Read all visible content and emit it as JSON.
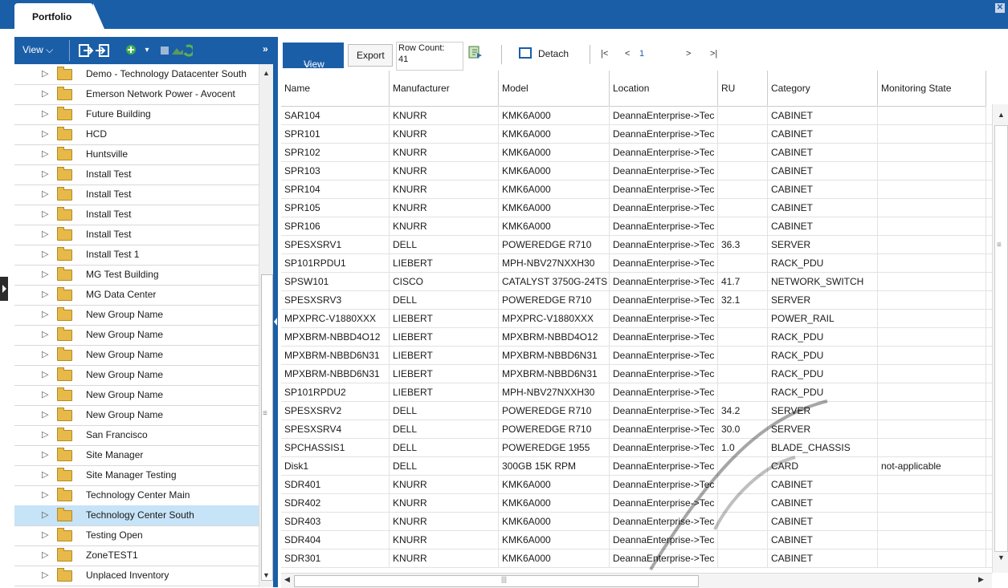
{
  "window": {
    "tab_label": "Portfolio",
    "close_icon": "close-icon"
  },
  "left_panel": {
    "view_label": "View",
    "expand_label": "»",
    "icons": [
      "move-in-icon",
      "move-out-icon",
      "add-icon",
      "dropdown-icon",
      "chart-icon",
      "refresh-icon"
    ],
    "tree_items": [
      {
        "label": "Demo - Technology Datacenter South",
        "selected": false
      },
      {
        "label": "Emerson Network Power - Avocent",
        "selected": false
      },
      {
        "label": "Future Building",
        "selected": false
      },
      {
        "label": "HCD",
        "selected": false
      },
      {
        "label": "Huntsville",
        "selected": false
      },
      {
        "label": "Install Test",
        "selected": false
      },
      {
        "label": "Install Test",
        "selected": false
      },
      {
        "label": "Install Test",
        "selected": false
      },
      {
        "label": "Install Test",
        "selected": false
      },
      {
        "label": "Install Test 1",
        "selected": false
      },
      {
        "label": "MG Test Building",
        "selected": false
      },
      {
        "label": "MG Data Center",
        "selected": false
      },
      {
        "label": "New Group Name",
        "selected": false
      },
      {
        "label": "New Group Name",
        "selected": false
      },
      {
        "label": "New Group Name",
        "selected": false
      },
      {
        "label": "New Group Name",
        "selected": false
      },
      {
        "label": "New Group Name",
        "selected": false
      },
      {
        "label": "New Group Name",
        "selected": false
      },
      {
        "label": "San Francisco",
        "selected": false
      },
      {
        "label": "Site Manager",
        "selected": false
      },
      {
        "label": "Site Manager Testing",
        "selected": false
      },
      {
        "label": "Technology Center Main",
        "selected": false
      },
      {
        "label": "Technology Center South",
        "selected": true
      },
      {
        "label": "Testing Open",
        "selected": false
      },
      {
        "label": "ZoneTEST1",
        "selected": false
      },
      {
        "label": "Unplaced Inventory",
        "selected": false
      }
    ]
  },
  "toolbar": {
    "view_label": "View",
    "export_label": "Export",
    "row_count_label": "Row Count:",
    "row_count_value": "41",
    "detach_label": "Detach",
    "pager": {
      "first": "|<",
      "prev": "<",
      "page": "1",
      "next": ">",
      "last": ">|"
    }
  },
  "grid": {
    "columns": [
      "Name",
      "Manufacturer",
      "Model",
      "Location",
      "RU",
      "Category",
      "Monitoring State"
    ],
    "rows": [
      [
        "SAR104",
        "KNURR",
        "KMK6A000",
        "DeannaEnterprise->Tec",
        "",
        "CABINET",
        ""
      ],
      [
        "SPR101",
        "KNURR",
        "KMK6A000",
        "DeannaEnterprise->Tec",
        "",
        "CABINET",
        ""
      ],
      [
        "SPR102",
        "KNURR",
        "KMK6A000",
        "DeannaEnterprise->Tec",
        "",
        "CABINET",
        ""
      ],
      [
        "SPR103",
        "KNURR",
        "KMK6A000",
        "DeannaEnterprise->Tec",
        "",
        "CABINET",
        ""
      ],
      [
        "SPR104",
        "KNURR",
        "KMK6A000",
        "DeannaEnterprise->Tec",
        "",
        "CABINET",
        ""
      ],
      [
        "SPR105",
        "KNURR",
        "KMK6A000",
        "DeannaEnterprise->Tec",
        "",
        "CABINET",
        ""
      ],
      [
        "SPR106",
        "KNURR",
        "KMK6A000",
        "DeannaEnterprise->Tec",
        "",
        "CABINET",
        ""
      ],
      [
        "SPESXSRV1",
        "DELL",
        "POWEREDGE R710",
        "DeannaEnterprise->Tec",
        "36.3",
        "SERVER",
        ""
      ],
      [
        "SP101RPDU1",
        "LIEBERT",
        "MPH-NBV27NXXH30",
        "DeannaEnterprise->Tec",
        "",
        "RACK_PDU",
        ""
      ],
      [
        "SPSW101",
        "CISCO",
        "CATALYST 3750G-24TS",
        "DeannaEnterprise->Tec",
        "41.7",
        "NETWORK_SWITCH",
        ""
      ],
      [
        "SPESXSRV3",
        "DELL",
        "POWEREDGE R710",
        "DeannaEnterprise->Tec",
        "32.1",
        "SERVER",
        ""
      ],
      [
        "MPXPRC-V1880XXX",
        "LIEBERT",
        "MPXPRC-V1880XXX",
        "DeannaEnterprise->Tec",
        "",
        "POWER_RAIL",
        ""
      ],
      [
        "MPXBRM-NBBD4O12",
        "LIEBERT",
        "MPXBRM-NBBD4O12",
        "DeannaEnterprise->Tec",
        "",
        "RACK_PDU",
        ""
      ],
      [
        "MPXBRM-NBBD6N31",
        "LIEBERT",
        "MPXBRM-NBBD6N31",
        "DeannaEnterprise->Tec",
        "",
        "RACK_PDU",
        ""
      ],
      [
        "MPXBRM-NBBD6N31",
        "LIEBERT",
        "MPXBRM-NBBD6N31",
        "DeannaEnterprise->Tec",
        "",
        "RACK_PDU",
        ""
      ],
      [
        "SP101RPDU2",
        "LIEBERT",
        "MPH-NBV27NXXH30",
        "DeannaEnterprise->Tec",
        "",
        "RACK_PDU",
        ""
      ],
      [
        "SPESXSRV2",
        "DELL",
        "POWEREDGE R710",
        "DeannaEnterprise->Tec",
        "34.2",
        "SERVER",
        ""
      ],
      [
        "SPESXSRV4",
        "DELL",
        "POWEREDGE R710",
        "DeannaEnterprise->Tec",
        "30.0",
        "SERVER",
        ""
      ],
      [
        "SPCHASSIS1",
        "DELL",
        "POWEREDGE 1955",
        "DeannaEnterprise->Tec",
        "1.0",
        "BLADE_CHASSIS",
        ""
      ],
      [
        "Disk1",
        "DELL",
        "300GB 15K RPM",
        "DeannaEnterprise->Tec",
        "",
        "CARD",
        "not-applicable"
      ],
      [
        "SDR401",
        "KNURR",
        "KMK6A000",
        "DeannaEnterprise->Tec",
        "",
        "CABINET",
        ""
      ],
      [
        "SDR402",
        "KNURR",
        "KMK6A000",
        "DeannaEnterprise->Tec",
        "",
        "CABINET",
        ""
      ],
      [
        "SDR403",
        "KNURR",
        "KMK6A000",
        "DeannaEnterprise->Tec",
        "",
        "CABINET",
        ""
      ],
      [
        "SDR404",
        "KNURR",
        "KMK6A000",
        "DeannaEnterprise->Tec",
        "",
        "CABINET",
        ""
      ],
      [
        "SDR301",
        "KNURR",
        "KMK6A000",
        "DeannaEnterprise->Tec",
        "",
        "CABINET",
        ""
      ]
    ]
  },
  "colors": {
    "accent": "#1a5ea8",
    "selected_row": "#c6e3f7",
    "folder": "#e6b949"
  }
}
